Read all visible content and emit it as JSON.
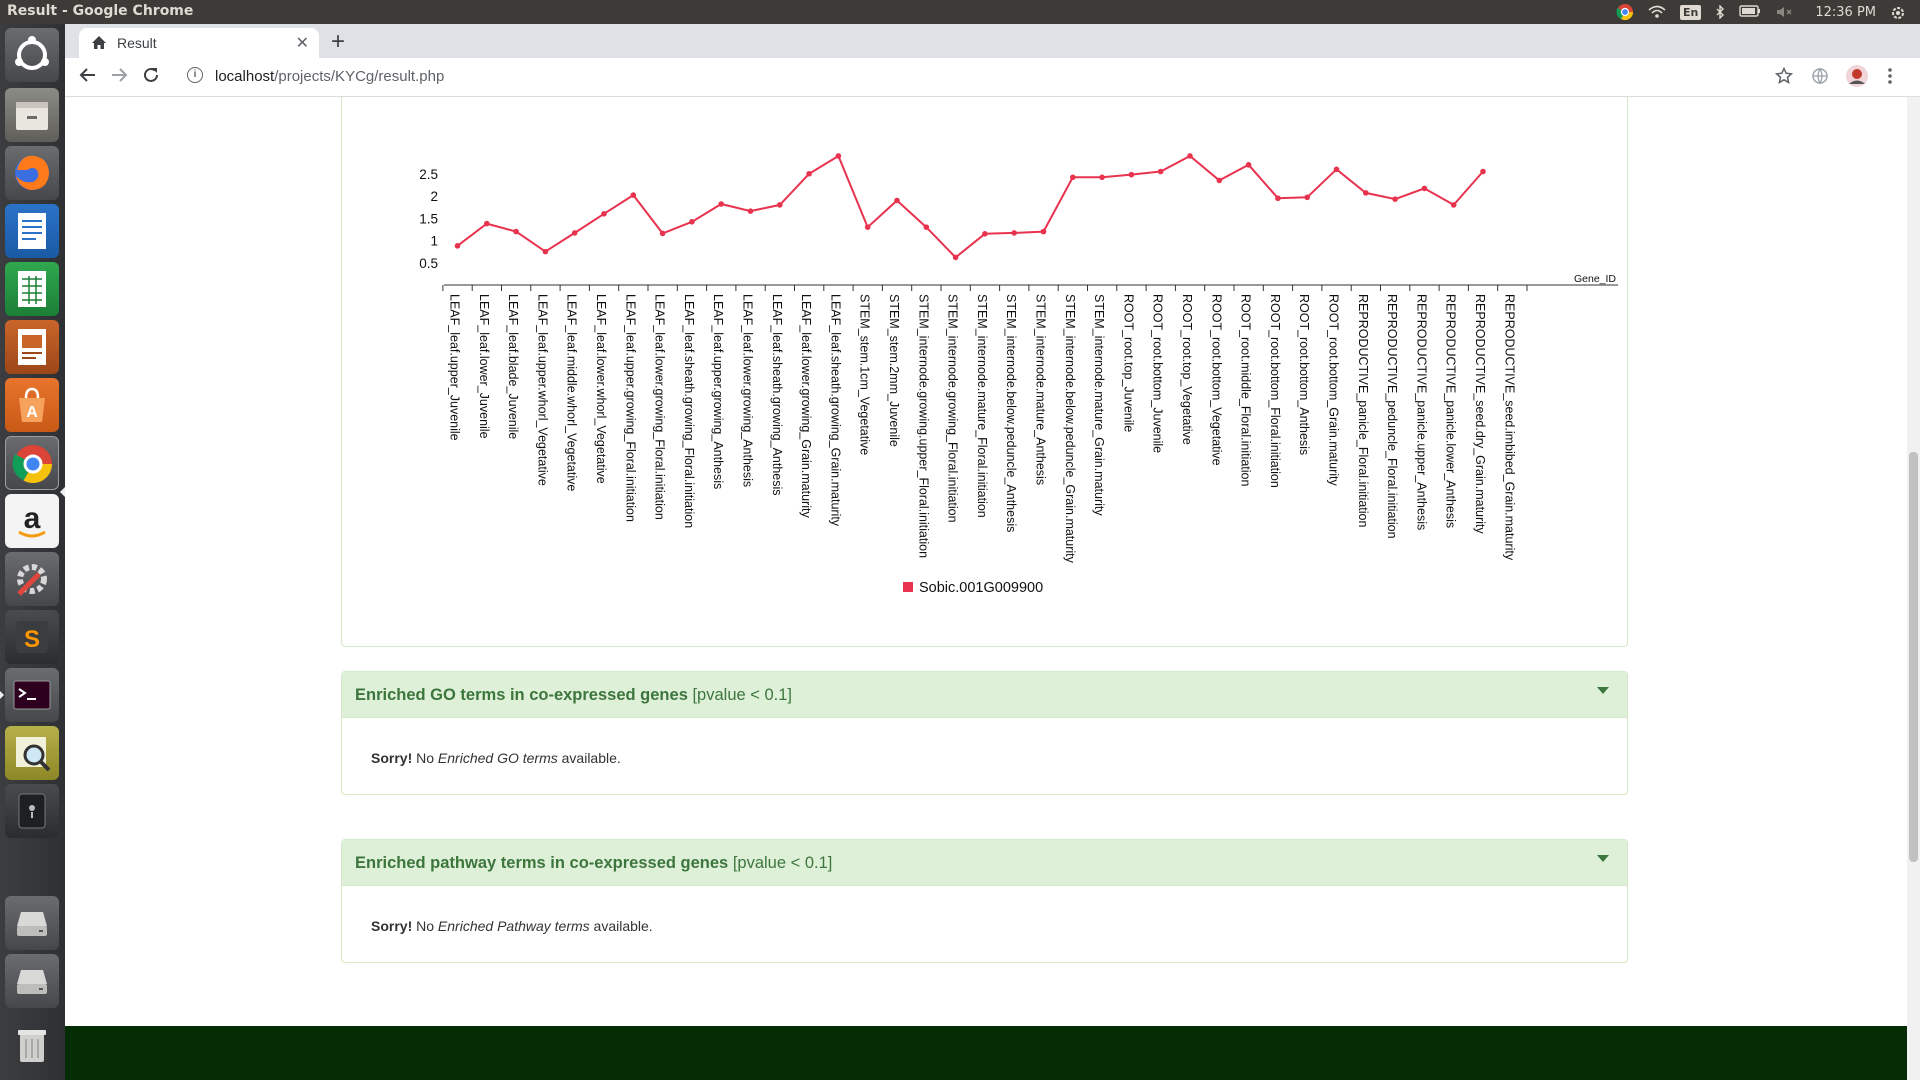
{
  "os": {
    "window_title": "Result - Google Chrome",
    "clock": "12:36 PM",
    "keyboard_layout": "En"
  },
  "launcher": [
    "ubuntu-dash-icon",
    "files-icon",
    "firefox-icon",
    "writer-icon",
    "calc-icon",
    "impress-icon",
    "software-center-icon",
    "chrome-icon",
    "amazon-icon",
    "system-settings-icon",
    "sublime-text-icon",
    "terminal-icon",
    "image-viewer-icon",
    "system-monitor-icon",
    "drive-icon",
    "drive-icon",
    "trash-icon"
  ],
  "browser": {
    "tab_title": "Result",
    "url_host": "localhost",
    "url_path": "/projects/KYCg/result.php"
  },
  "chart_data": {
    "type": "line",
    "xlabel": "Gene_ID",
    "y_ticks": [
      "0.5",
      "1",
      "1.5",
      "2",
      "2.5"
    ],
    "colors": {
      "series": "#e8334f"
    },
    "categories": [
      "LEAF_leaf.upper_Juvenile",
      "LEAF_leaf.lower_Juvenile",
      "LEAF_leaf.blade_Juvenile",
      "LEAF_leaf.upper.whorl_Vegetative",
      "LEAF_leaf.middle.whorl_Vegetative",
      "LEAF_leaf.lower.whorl_Vegetative",
      "LEAF_leaf.upper.growing_Floral.initiation",
      "LEAF_leaf.lower.growing_Floral.initiation",
      "LEAF_leaf.sheath.growing_Floral.initiation",
      "LEAF_leaf.upper.growing_Anthesis",
      "LEAF_leaf.lower.growing_Anthesis",
      "LEAF_leaf.sheath.growing_Anthesis",
      "LEAF_leaf.lower.growing_Grain.maturity",
      "LEAF_leaf.sheath.growing_Grain.maturity",
      "STEM_stem.1cm_Vegetative",
      "STEM_stem.2mm_Juvenile",
      "STEM_internode.growing.upper_Floral.initiation",
      "STEM_internode.growing_Floral.initiation",
      "STEM_internode.mature_Floral.initiation",
      "STEM_internode.below.peduncle_Anthesis",
      "STEM_internode.mature_Anthesis",
      "STEM_internode.below.peduncle_Grain.maturity",
      "STEM_internode.mature_Grain.maturity",
      "ROOT_root.top_Juvenile",
      "ROOT_root.bottom_Juvenile",
      "ROOT_root.top_Vegetative",
      "ROOT_root.bottom_Vegetative",
      "ROOT_root.middle_Floral.initiation",
      "ROOT_root.bottom_Floral.initiation",
      "ROOT_root.bottom_Anthesis",
      "ROOT_root.bottom_Grain.maturity",
      "REPRODUCTIVE_panicle_Floral.initiation",
      "REPRODUCTIVE_peduncle_Floral.initiation",
      "REPRODUCTIVE_panicle.upper_Anthesis",
      "REPRODUCTIVE_panicle.lower_Anthesis",
      "REPRODUCTIVE_seed.dry_Grain.maturity",
      "REPRODUCTIVE_seed.imbibed_Grain.maturity"
    ],
    "series": [
      {
        "name": "Sobic.001G009900",
        "values": [
          0.88,
          1.38,
          1.2,
          0.75,
          1.17,
          1.6,
          2.02,
          1.16,
          1.42,
          1.82,
          1.66,
          1.8,
          2.5,
          2.9,
          1.3,
          1.9,
          1.3,
          0.62,
          1.15,
          1.17,
          1.2,
          2.42,
          2.42,
          2.48,
          2.55,
          2.9,
          2.35,
          2.7,
          1.95,
          1.97,
          2.6,
          2.07,
          1.93,
          2.17,
          1.8,
          2.55,
          null
        ]
      }
    ]
  },
  "panels": [
    {
      "title": "Enriched GO terms in co-expressed genes",
      "qualifier": "[pvalue < 0.1]",
      "sorry": "Sorry!",
      "pre": " No ",
      "term": "Enriched GO terms",
      "post": " available."
    },
    {
      "title": "Enriched pathway terms in co-expressed genes",
      "qualifier": "[pvalue < 0.1]",
      "sorry": "Sorry!",
      "pre": " No ",
      "term": "Enriched Pathway terms",
      "post": " available."
    }
  ]
}
